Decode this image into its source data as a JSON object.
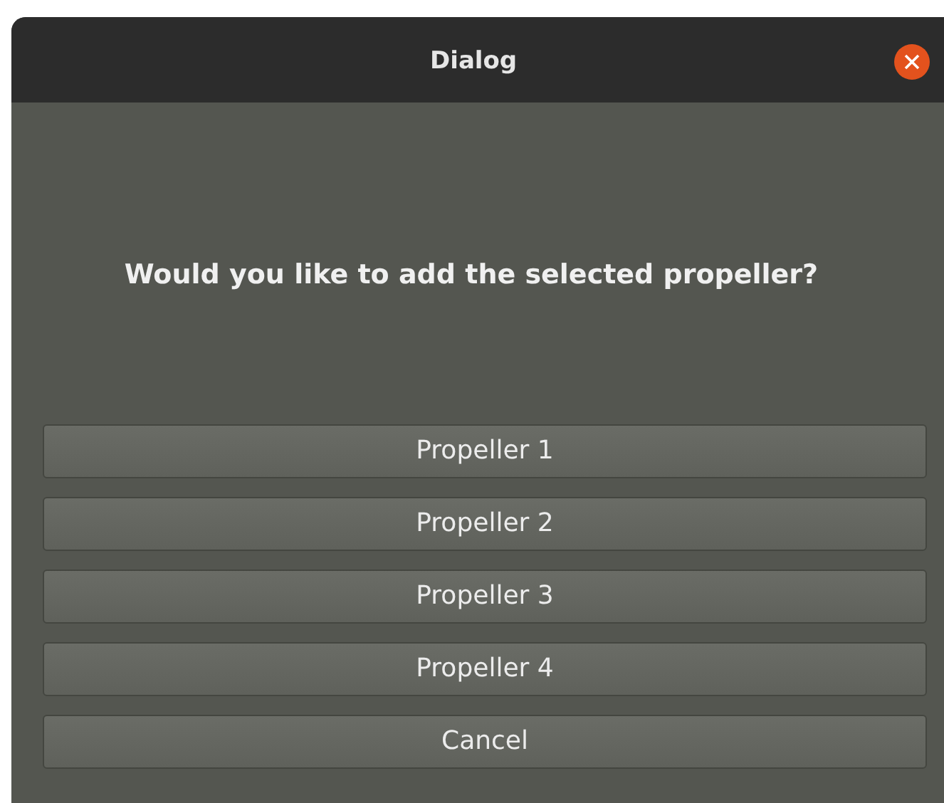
{
  "window": {
    "title": "Dialog"
  },
  "question": "Would you like to add the selected propeller?",
  "buttons": [
    {
      "label": "Propeller 1"
    },
    {
      "label": "Propeller 2"
    },
    {
      "label": "Propeller 3"
    },
    {
      "label": "Propeller 4"
    },
    {
      "label": "Cancel"
    }
  ]
}
